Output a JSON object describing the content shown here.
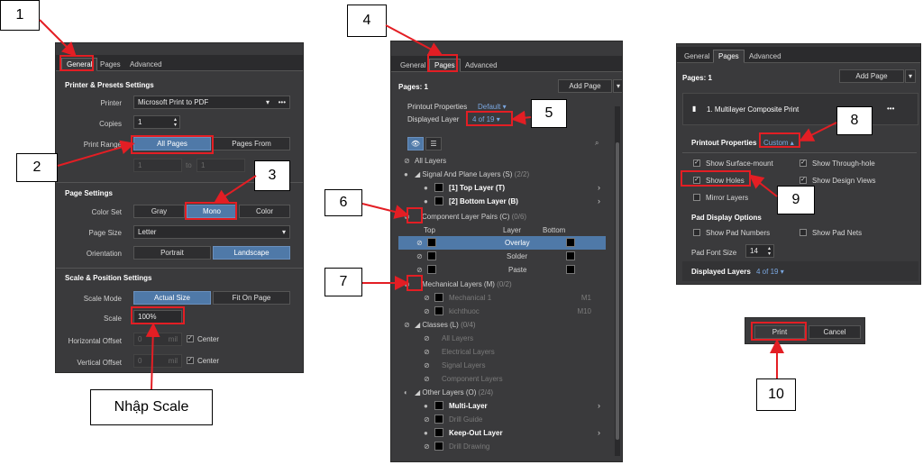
{
  "callouts": {
    "c1": "1",
    "c2": "2",
    "c3": "3",
    "c4": "4",
    "c5": "5",
    "c6": "6",
    "c7": "7",
    "c8": "8",
    "c9": "9",
    "c10": "10",
    "scale_note": "Nhập Scale"
  },
  "colors": {
    "accent": "#4f79a8",
    "red": "#e31e24",
    "bg": "#3a3a3c"
  },
  "general": {
    "tabs": [
      "General",
      "Pages",
      "Advanced"
    ],
    "printer_section": "Printer & Presets Settings",
    "printer_label": "Printer",
    "printer_value": "Microsoft Print to PDF",
    "copies_label": "Copies",
    "copies_value": "1",
    "range_label": "Print Range",
    "all_pages": "All Pages",
    "pages_from": "Pages From",
    "from_value": "1",
    "to_label": "to",
    "to_value": "1",
    "page_section": "Page Settings",
    "colorset_label": "Color Set",
    "gray": "Gray",
    "mono": "Mono",
    "color": "Color",
    "pagesize_label": "Page Size",
    "pagesize_value": "Letter",
    "orientation_label": "Orientation",
    "portrait": "Portrait",
    "landscape": "Landscape",
    "scale_section": "Scale & Position Settings",
    "scalemode_label": "Scale Mode",
    "actual_size": "Actual Size",
    "fit_on_page": "Fit On Page",
    "scale_label": "Scale",
    "scale_value": "100%",
    "hoffset_label": "Horizontal Offset",
    "voffset_label": "Vertical Offset",
    "offset_value": "0",
    "unit": "mil",
    "center": "Center"
  },
  "pages": {
    "tabs": [
      "General",
      "Pages",
      "Advanced"
    ],
    "pages_count": "Pages: 1",
    "add_page": "Add Page",
    "printout_props": "Printout Properties",
    "default": "Default",
    "displayed_layer": "Displayed Layer",
    "layer_count": "4 of 19",
    "rows": [
      {
        "text": "All Layers"
      },
      {
        "text": "Signal And Plane Layers (S)",
        "sub": "(2/2)"
      },
      {
        "text": "[1] Top Layer (T)"
      },
      {
        "text": "[2] Bottom Layer (B)"
      },
      {
        "text": "Component Layer Pairs (C)",
        "sub": "(0/6)"
      },
      {
        "text": "Overlay"
      },
      {
        "text": "Solder"
      },
      {
        "text": "Paste"
      },
      {
        "text": "Mechanical Layers (M)",
        "sub": "(0/2)"
      },
      {
        "text": "Mechanical 1",
        "code": "M1"
      },
      {
        "text": "kichthuoc",
        "code": "M10"
      },
      {
        "text": "Classes (L)",
        "sub": "(0/4)"
      },
      {
        "text": "All Layers"
      },
      {
        "text": "Electrical Layers"
      },
      {
        "text": "Signal Layers"
      },
      {
        "text": "Component Layers"
      },
      {
        "text": "Other Layers (O)",
        "sub": "(2/4)"
      },
      {
        "text": "Multi-Layer"
      },
      {
        "text": "Drill Guide"
      },
      {
        "text": "Keep-Out Layer"
      },
      {
        "text": "Drill Drawing"
      }
    ],
    "col_top": "Top",
    "col_layer": "Layer",
    "col_bottom": "Bottom"
  },
  "pages2": {
    "tabs": [
      "General",
      "Pages",
      "Advanced"
    ],
    "pages_count": "Pages: 1",
    "add_page": "Add Page",
    "item": "1. Multilayer Composite Print",
    "printout_props": "Printout Properties",
    "custom": "Custom",
    "show_surface": "Show Surface-mount",
    "show_through": "Show Through-hole",
    "show_holes": "Show Holes",
    "show_design": "Show Design Views",
    "mirror": "Mirror Layers",
    "pad_options": "Pad Display Options",
    "pad_numbers": "Show Pad Numbers",
    "pad_nets": "Show Pad Nets",
    "pad_font_label": "Pad Font Size",
    "pad_font_value": "14",
    "displayed_layers": "Displayed Layers",
    "layer_count": "4 of 19"
  },
  "dialog": {
    "print": "Print",
    "cancel": "Cancel"
  }
}
